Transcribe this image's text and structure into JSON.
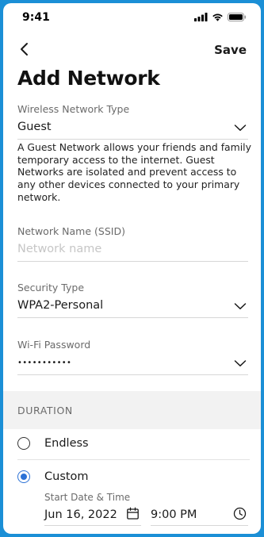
{
  "status": {
    "time": "9:41"
  },
  "nav": {
    "save_label": "Save"
  },
  "page": {
    "title": "Add Network"
  },
  "network_type": {
    "label": "Wireless Network Type",
    "value": "Guest"
  },
  "description": "A Guest Network allows your friends and family temporary access to the internet. Guest Networks are isolated and prevent access to any other devices connected to your primary network.",
  "ssid": {
    "label": "Network Name (SSID)",
    "placeholder": "Network name"
  },
  "security": {
    "label": "Security Type",
    "value": "WPA2-Personal"
  },
  "password": {
    "label": "Wi-Fi Password",
    "value": "•••••••••••"
  },
  "duration": {
    "section_title": "DURATION",
    "options": [
      {
        "label": "Endless",
        "selected": false
      },
      {
        "label": "Custom",
        "selected": true
      }
    ],
    "start_label": "Start Date & Time",
    "start_date": "Jun 16, 2022",
    "start_time": "9:00 PM"
  },
  "colors": {
    "frame": "#1b8fd6",
    "accent": "#2c72d6"
  },
  "icons": [
    "back-chevron-icon",
    "chevron-down-icon",
    "calendar-icon",
    "clock-icon",
    "signal-icon",
    "wifi-icon",
    "battery-icon"
  ]
}
